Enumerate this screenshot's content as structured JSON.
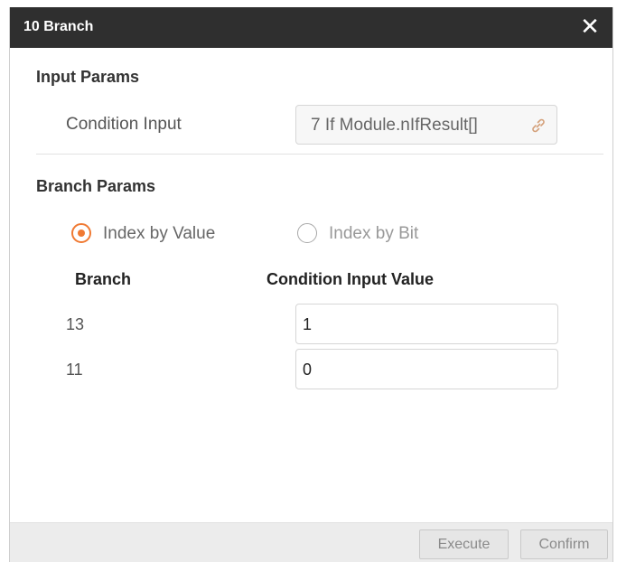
{
  "dialog": {
    "title": "10 Branch",
    "close_icon": "close-icon"
  },
  "input_params": {
    "section_title": "Input Params",
    "condition_input_label": "Condition Input",
    "condition_input_value": "7 If Module.nIfResult[]",
    "link_icon": "link-icon"
  },
  "branch_params": {
    "section_title": "Branch Params",
    "mode_options": [
      {
        "label": "Index by Value",
        "selected": true
      },
      {
        "label": "Index by Bit",
        "selected": false
      }
    ],
    "columns": [
      "Branch",
      "Condition Input Value"
    ],
    "rows": [
      {
        "branch": "13",
        "value": "1"
      },
      {
        "branch": "11",
        "value": "0"
      }
    ]
  },
  "footer": {
    "execute_label": "Execute",
    "confirm_label": "Confirm"
  },
  "colors": {
    "titlebar": "#2f2f2f",
    "accent": "#f07a33",
    "footer": "#ececec"
  }
}
